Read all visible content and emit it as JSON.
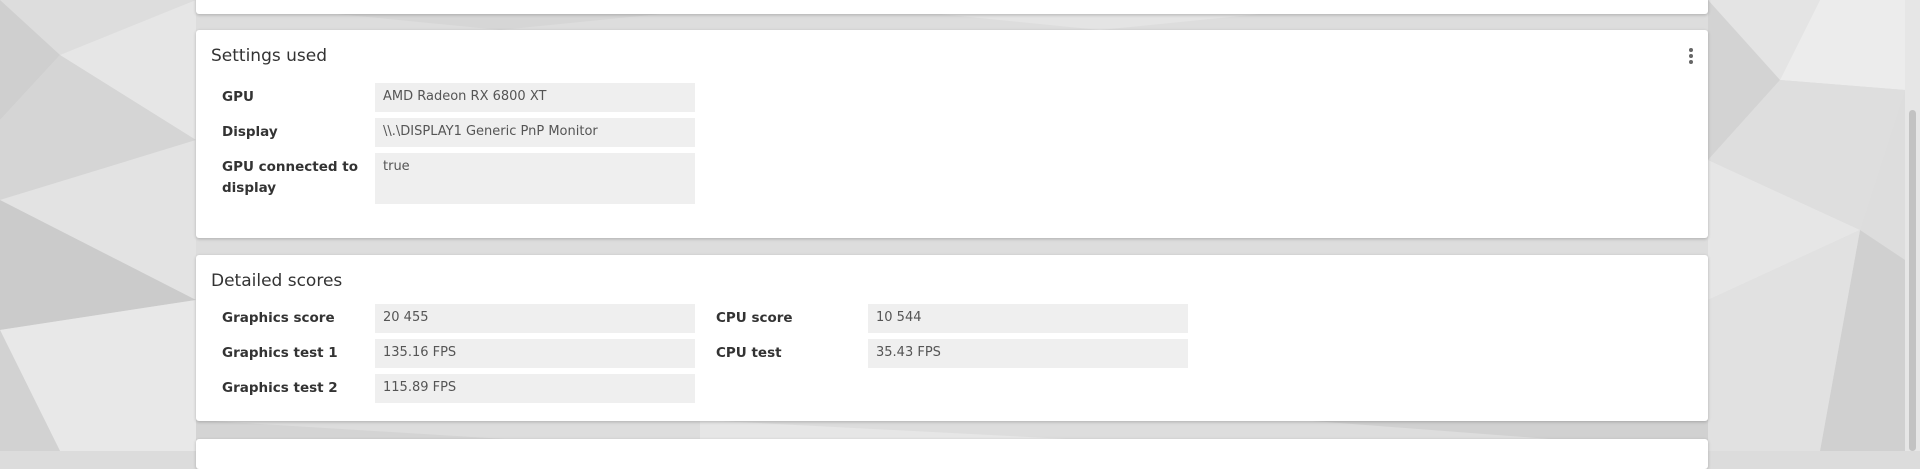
{
  "settings": {
    "title": "Settings used",
    "menu_icon": "more-vertical-icon",
    "rows": [
      {
        "label": "GPU",
        "value": "AMD Radeon RX 6800 XT"
      },
      {
        "label": "Display",
        "value": "\\\\.\\DISPLAY1 Generic PnP Monitor"
      },
      {
        "label": "GPU connected to display",
        "value": "true"
      }
    ]
  },
  "detailed": {
    "title": "Detailed scores",
    "left": [
      {
        "label": "Graphics score",
        "value": "20 455"
      },
      {
        "label": "Graphics test 1",
        "value": "135.16 FPS"
      },
      {
        "label": "Graphics test 2",
        "value": "115.89 FPS"
      }
    ],
    "right": [
      {
        "label": "CPU score",
        "value": "10 544"
      },
      {
        "label": "CPU test",
        "value": "35.43 FPS"
      }
    ]
  }
}
